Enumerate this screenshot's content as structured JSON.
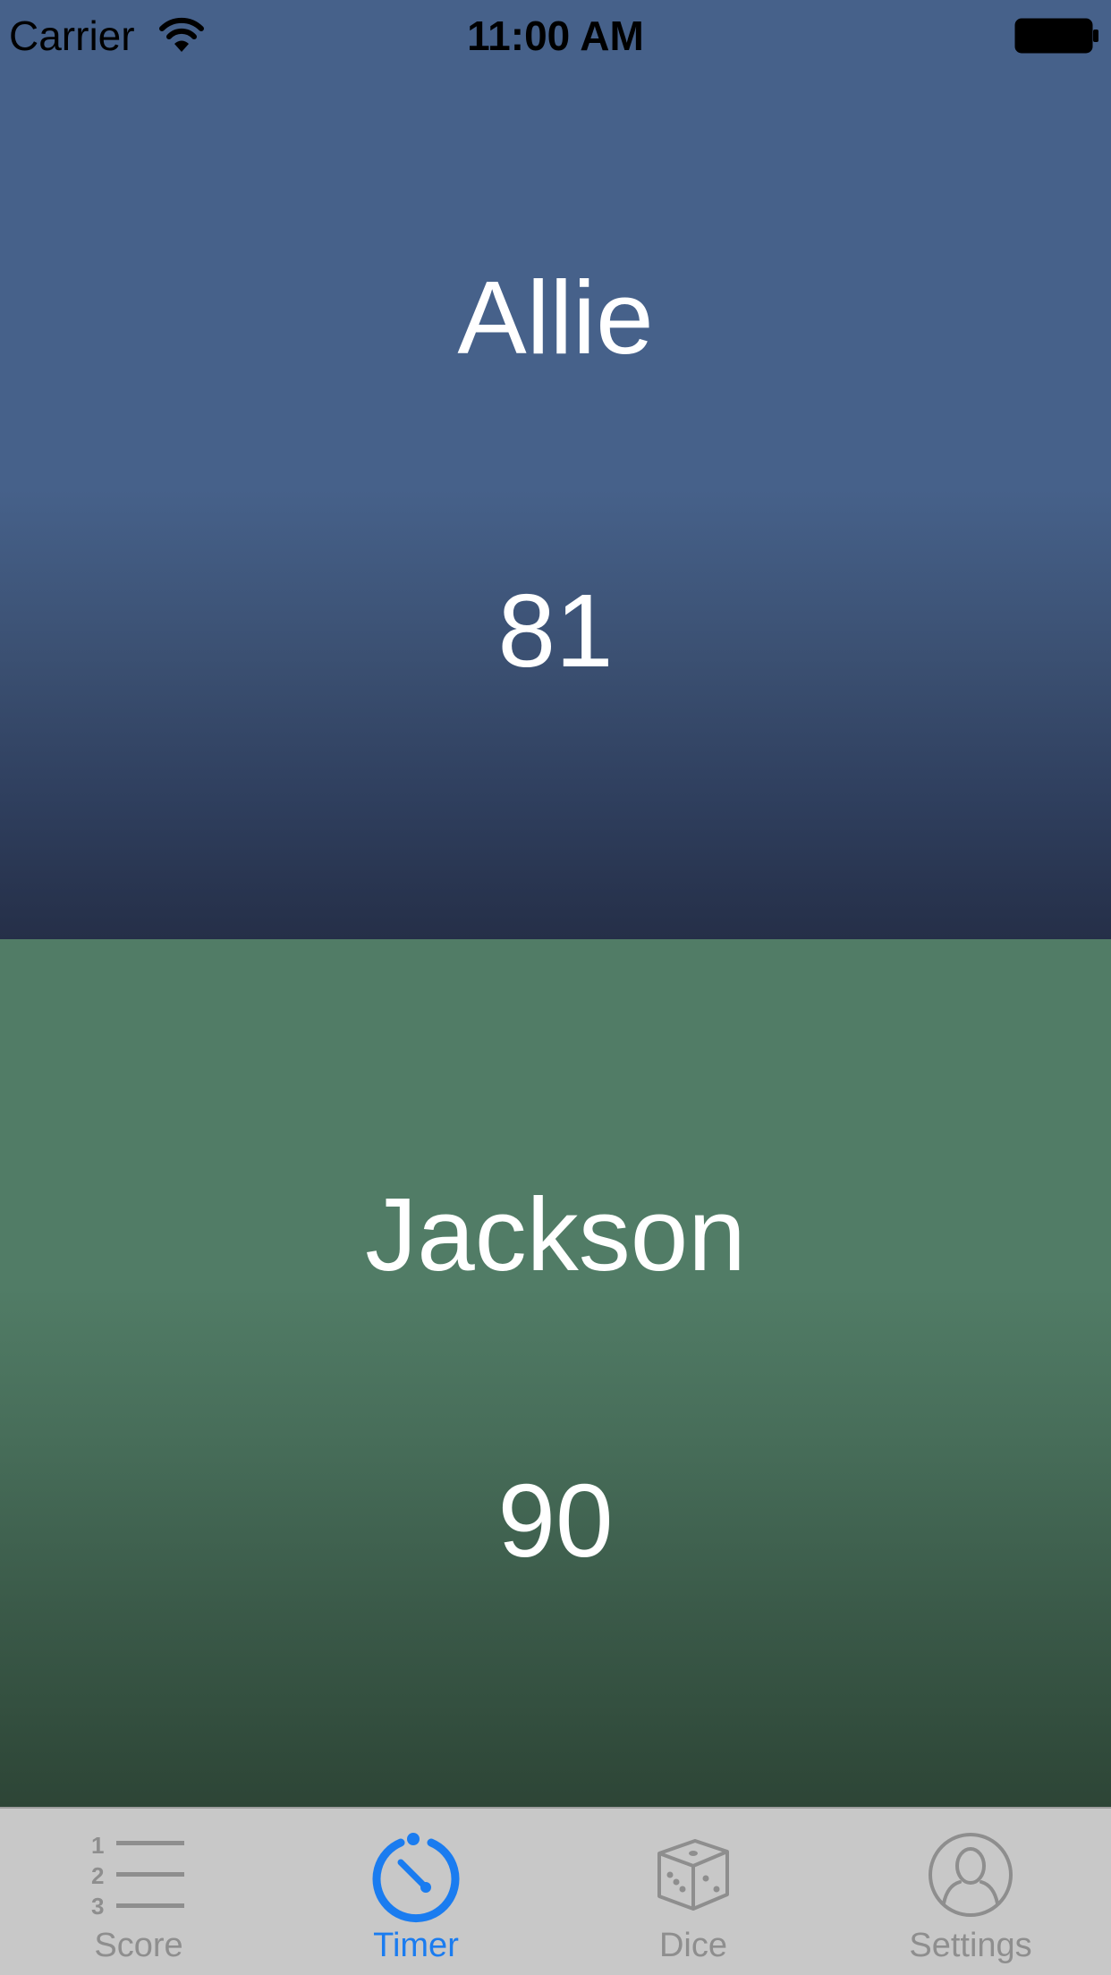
{
  "status_bar": {
    "carrier": "Carrier",
    "time": "11:00 AM"
  },
  "players": [
    {
      "name": "Allie",
      "score": "81",
      "color": "#46618a"
    },
    {
      "name": "Jackson",
      "score": "90",
      "color": "#517c66"
    }
  ],
  "tab_bar": {
    "active_tab": "Timer",
    "active_color": "#1a7cf0",
    "inactive_color": "#8e8e8e",
    "tabs": [
      {
        "label": "Score",
        "icon": "numbered-list-icon"
      },
      {
        "label": "Timer",
        "icon": "stopwatch-icon"
      },
      {
        "label": "Dice",
        "icon": "dice-icon"
      },
      {
        "label": "Settings",
        "icon": "person-icon"
      }
    ]
  }
}
